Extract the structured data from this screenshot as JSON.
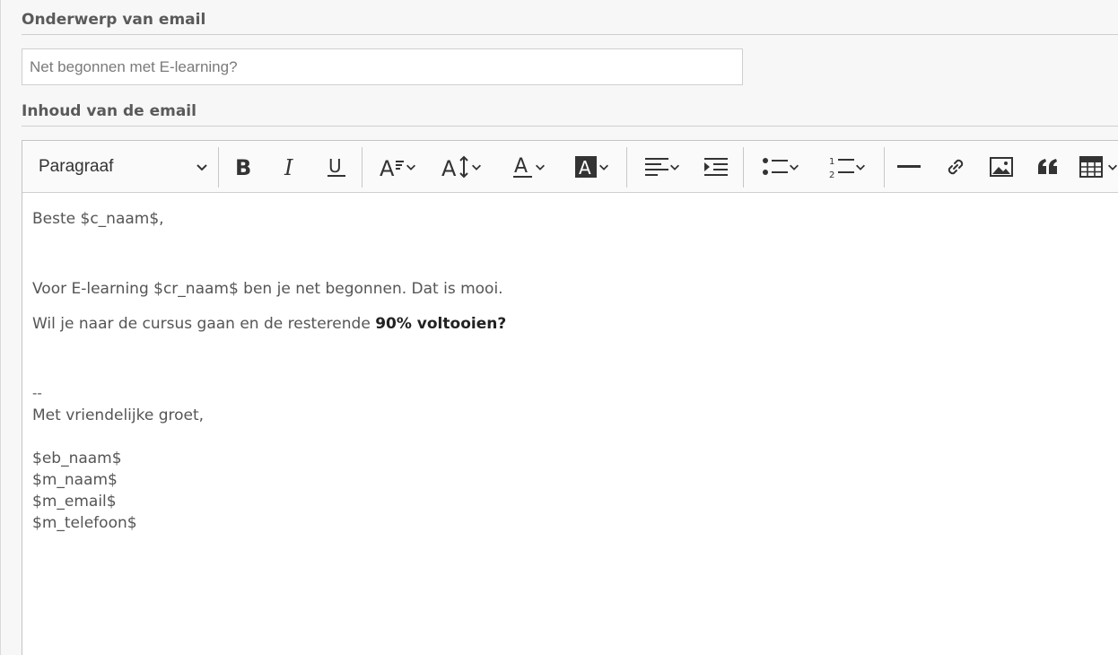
{
  "subject": {
    "label": "Onderwerp van email",
    "placeholder": "Net begonnen met E-learning?"
  },
  "body": {
    "label": "Inhoud van de email"
  },
  "toolbar": {
    "heading_value": "Paragraaf",
    "icons": [
      "bold-icon",
      "italic-icon",
      "underline-icon",
      "font-size-icon",
      "line-height-icon",
      "font-color-icon",
      "font-background-color-icon",
      "alignment-icon",
      "indent-icon",
      "bulleted-list-icon",
      "numbered-list-icon",
      "horizontal-line-icon",
      "link-icon",
      "image-icon",
      "blockquote-icon",
      "table-icon"
    ]
  },
  "content": {
    "greeting": "Beste $c_naam$,",
    "line1": "Voor E-learning $cr_naam$ ben je net begonnen. Dat is mooi.",
    "line2_prefix": "Wil je naar de cursus gaan en de resterende ",
    "line2_bold": "90% voltooien?",
    "sig_dash": "--",
    "sig_regards": "Met vriendelijke groet,",
    "sig_eb": "$eb_naam$",
    "sig_m_naam": "$m_naam$",
    "sig_m_email": "$m_email$",
    "sig_m_tel": "$m_telefoon$"
  },
  "colors": {
    "border": "#cfcfcf",
    "toolbar_bg": "#fafafa",
    "text": "#555555"
  }
}
